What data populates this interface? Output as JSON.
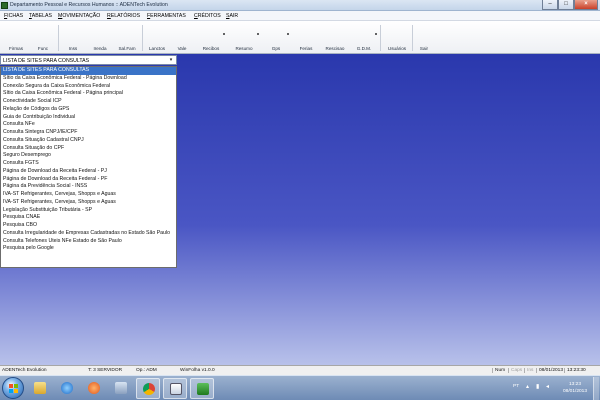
{
  "window": {
    "title": "Departamento Pessoal e Recursos Humanos :: ADENTech Evolution"
  },
  "menu": {
    "items": [
      {
        "key": "F",
        "rest": "ICHAS"
      },
      {
        "key": "T",
        "rest": "ABELAS"
      },
      {
        "key": "M",
        "rest": "OVIMENTAÇÃO"
      },
      {
        "key": "R",
        "rest": "ELATÓRIOS"
      },
      {
        "key": "F",
        "rest": "ERRAMENTAS"
      },
      {
        "key": "C",
        "rest": "RÉDITOS"
      },
      {
        "key": "S",
        "rest": "AIR"
      }
    ]
  },
  "toolbar": {
    "buttons": [
      "Firmas",
      "Func",
      "Inss",
      "Irenda",
      "Sal.Fam",
      "Lanctos",
      "Vale",
      "Recibos",
      "Resumo",
      "Gps",
      "Ferias",
      "Rescisao",
      "G.D.M.",
      "Usuários",
      "Sair"
    ]
  },
  "combo": {
    "value": "LISTA DE SITES PARA CONSULTAS",
    "arrow": "▾"
  },
  "dropdown": {
    "options": [
      "LISTA DE SITES PARA CONSULTAS",
      "Sítio da Caixa Econômica Federal - Página Download",
      "Conexão Segura da Caixa Econômica Federal",
      "Sítio da Caixa Econômica Federal - Página principal",
      "Conectividade Social ICP",
      "Relação de Códigos da GPS",
      "Guia de Contribuição Individual",
      "Consulta NFe",
      "Consulta Sintegra CNPJ/IE/CPF",
      "Consulta Situação Cadastral CNPJ",
      "Consulta Situação do CPF",
      "Seguro Desemprego",
      "Consulta FGTS",
      "Página de Download da Receita Federal - PJ",
      "Página de Download da Receita Federal - PF",
      "Página da Previdência Social - INSS",
      "IVA-ST Refrigerantes, Cervejas, Shopps e Aguas",
      "IVA-ST Refrigerantes, Cervejas, Shopps e Aguas",
      "Legislação Substituição Tributária - SP",
      "Pesquisa CNAE",
      "Pesquisa CBO",
      "Consulta Irregularidade de Empresas Cadastradas no Estado São Paulo",
      "Consulta Telefones Úteis NFe Estado de São Paulo",
      "Pesquisa pelo Google"
    ],
    "selected_index": 0
  },
  "statusbar": {
    "app": "ADENTech Evolution",
    "terminal": "T: 3 SERVIDOR",
    "operator": "Op.: ADM",
    "version": "WinFolha v1.0.0",
    "num": "Num",
    "caps": "Caps",
    "ins": "Ins",
    "date": "08/01/2013",
    "time": "13:23:30"
  },
  "taskbar": {
    "language": "PT",
    "clock_time": "13:23",
    "clock_date": "08/01/2013",
    "apps": [
      "windows-explorer",
      "internet-explorer",
      "media-player",
      "ie-shortcut",
      "chrome",
      "app-window",
      "adentech-app"
    ]
  },
  "colors": {
    "desktop_top": "#2a38ad",
    "desktop_bottom": "#b8c1ea",
    "selection": "#3a73c7"
  }
}
